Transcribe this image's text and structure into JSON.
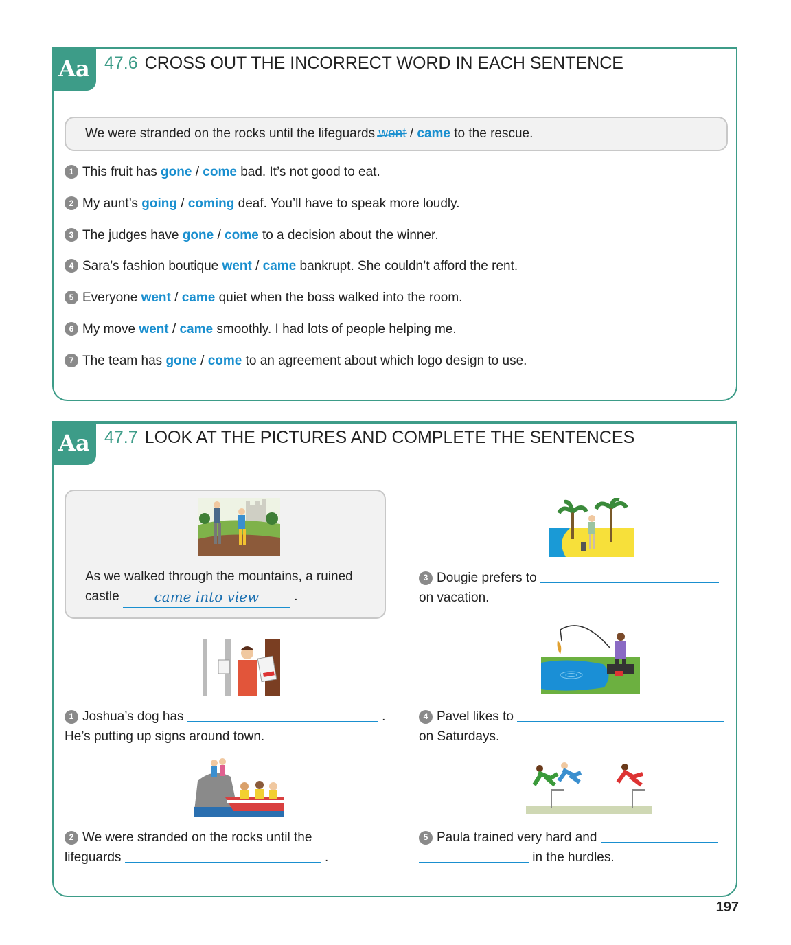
{
  "section_a": {
    "badge": "Aa",
    "number": "47.6",
    "title": "CROSS OUT THE INCORRECT WORD IN EACH SENTENCE",
    "example": {
      "before": "We were stranded on the rocks until the lifeguards",
      "crossed": "went",
      "sep": "/",
      "correct": "came",
      "after": "to the rescue."
    },
    "items": [
      {
        "n": "1",
        "before": "This fruit has",
        "a": "gone",
        "b": "come",
        "after": "bad. It’s not good to eat."
      },
      {
        "n": "2",
        "before": "My aunt’s",
        "a": "going",
        "b": "coming",
        "after": "deaf. You’ll have to speak more loudly."
      },
      {
        "n": "3",
        "before": "The judges have",
        "a": "gone",
        "b": "come",
        "after": "to a decision about the winner."
      },
      {
        "n": "4",
        "before": "Sara’s fashion boutique",
        "a": "went",
        "b": "came",
        "after": "bankrupt. She couldn’t afford the rent."
      },
      {
        "n": "5",
        "before": "Everyone",
        "a": "went",
        "b": "came",
        "after": "quiet when the boss walked into the room."
      },
      {
        "n": "6",
        "before": "My move",
        "a": "went",
        "b": "came",
        "after": "smoothly. I had lots of people helping me."
      },
      {
        "n": "7",
        "before": "The team has",
        "a": "gone",
        "b": "come",
        "after": "to an agreement about which logo design to use."
      }
    ]
  },
  "section_b": {
    "badge": "Aa",
    "number": "47.7",
    "title": "LOOK AT THE PICTURES AND COMPLETE THE SENTENCES",
    "example": {
      "line1": "As we walked through the mountains, a ruined",
      "line2_before": "castle",
      "answer": "came into view",
      "line2_after": "."
    },
    "items": [
      {
        "n": "1",
        "before": "Joshua’s dog has",
        "after": ".",
        "line2": "He’s putting up signs around town."
      },
      {
        "n": "2",
        "before": "We were stranded on the rocks until the",
        "line2_before": "lifeguards",
        "line2_after": "."
      },
      {
        "n": "3",
        "before": "Dougie prefers to",
        "line2": "on vacation."
      },
      {
        "n": "4",
        "before": "Pavel likes to",
        "line2": "on Saturdays."
      },
      {
        "n": "5",
        "before": "Paula trained very hard and",
        "line2_after": "in the hurdles."
      }
    ]
  },
  "page_number": "197",
  "colors": {
    "teal": "#3d9c88",
    "blue": "#1a8fcf"
  }
}
